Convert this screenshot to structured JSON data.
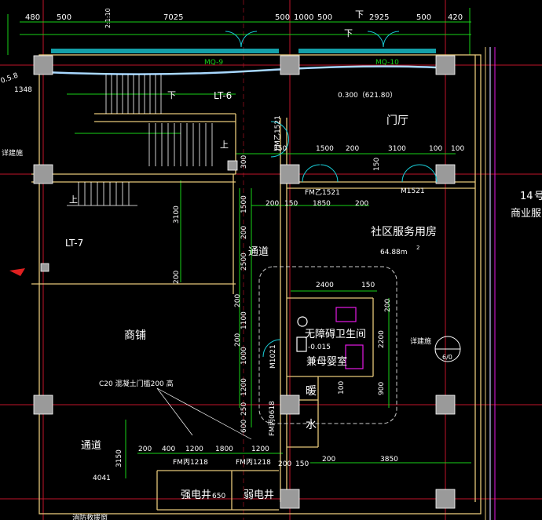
{
  "colors": {
    "background": "#000000",
    "wall": "#e6c87a",
    "axis": "#c0152a",
    "dim": "#19d219",
    "text": "#ffffff",
    "door": "#19c8d2",
    "column": "#9a9a9a",
    "fixture": "#e619e6",
    "window": "#7ec8ff"
  },
  "top_dims": [
    "480",
    "500",
    "7025",
    "500",
    "1000",
    "500",
    "2925",
    "500",
    "420"
  ],
  "window_tags": [
    "MQ-9",
    "MQ-10"
  ],
  "stair_marks": {
    "down_top": "下",
    "down_mid": "下",
    "up_right": "上",
    "up_left": "上",
    "small_dims": "2:1:10"
  },
  "rooms": {
    "lt6": "LT-6",
    "lt7": "LT-7",
    "lobby": "门厅",
    "lobby_elev": "0.300（621.80）",
    "community": "社区服务用房",
    "community_area": "64.88m",
    "area_unit": "2",
    "corridor": "通道",
    "shop": "商铺",
    "accessible_wc": "无障碍卫生间",
    "mother_baby": "兼母婴室",
    "wc_elev": "-0.015",
    "heating": "暖",
    "water": "水",
    "strong_shaft": "强电井",
    "weak_shaft": "弱电井",
    "corridor2": "通道",
    "shop14_no": "14",
    "shop14_suffix": "号",
    "shop14_label": "商业服"
  },
  "doors": {
    "fmz1521_vertical": "FM乙1521",
    "fmz1521": "FM乙1521",
    "m1521": "M1521",
    "m1021": "M1021",
    "fmc0618": "FM丙0618",
    "fmc1218_a": "FM丙1218",
    "fmc1218_b": "FM丙1218"
  },
  "notes": {
    "slab": "C20 混凝土门槛200 高",
    "detail": "详建施",
    "detail_left": "详建施",
    "detail_bubble_bottom": "6/0",
    "radius": "0.5.8",
    "dim_1348": "1348",
    "dim_4041": "4041",
    "shaft_650": "650",
    "fire_exit_label": "消防救援窗"
  },
  "dims": {
    "d350": "350",
    "d1500": "1500",
    "d200a": "200",
    "d3100": "3100",
    "d100a": "100",
    "d100b": "100",
    "d300v": "300",
    "d150v": "150",
    "d200b": "200",
    "d150b": "150",
    "d1850": "1850",
    "d200c": "200",
    "d1500v": "1500",
    "d3100v": "3100",
    "d200v1": "200",
    "d2500v": "2500",
    "d200v2": "200",
    "d2400": "2400",
    "d150c": "150",
    "d200v3": "200",
    "d1100v": "1100",
    "d200v4": "200",
    "d1000v": "1000",
    "d1200v": "1200",
    "d250v": "250",
    "d600v": "600",
    "d2200v": "2200",
    "d900v": "900",
    "d200v5": "200",
    "d100v": "100",
    "d200e": "200",
    "d3850": "3850",
    "d200f": "200",
    "d400": "400",
    "d1200a": "1200",
    "d1800": "1800",
    "d1200b": "1200",
    "d200g": "200",
    "d150d": "150",
    "d3150v": "3150"
  }
}
